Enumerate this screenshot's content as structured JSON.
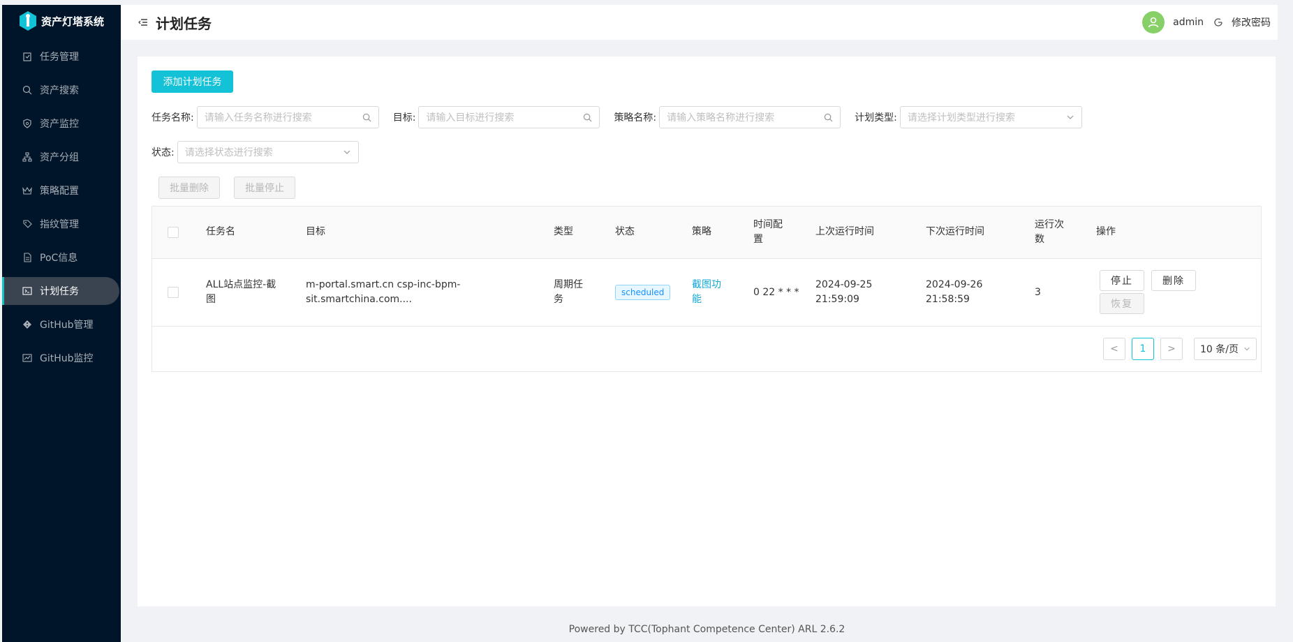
{
  "app": {
    "title": "资产灯塔系统"
  },
  "sidebar": {
    "items": [
      {
        "label": "任务管理",
        "icon": "clipboard-icon"
      },
      {
        "label": "资产搜索",
        "icon": "search-icon"
      },
      {
        "label": "资产监控",
        "icon": "monitor-icon"
      },
      {
        "label": "资产分组",
        "icon": "cluster-icon"
      },
      {
        "label": "策略配置",
        "icon": "crown-icon"
      },
      {
        "label": "指纹管理",
        "icon": "tag-icon"
      },
      {
        "label": "PoC信息",
        "icon": "file-icon"
      },
      {
        "label": "计划任务",
        "icon": "code-icon",
        "active": true
      },
      {
        "label": "GitHub管理",
        "icon": "git-icon"
      },
      {
        "label": "GitHub监控",
        "icon": "fund-icon"
      }
    ]
  },
  "header": {
    "title": "计划任务",
    "user": "admin",
    "change_password": "修改密码"
  },
  "toolbar": {
    "add_label": "添加计划任务"
  },
  "filters": {
    "task_name_label": "任务名称:",
    "task_name_placeholder": "请输入任务名称进行搜索",
    "target_label": "目标:",
    "target_placeholder": "请输入目标进行搜索",
    "policy_label": "策略名称:",
    "policy_placeholder": "请输入策略名称进行搜索",
    "plan_type_label": "计划类型:",
    "plan_type_placeholder": "请选择计划类型进行搜索",
    "status_label": "状态:",
    "status_placeholder": "请选择状态进行搜索"
  },
  "batch": {
    "delete_label": "批量删除",
    "stop_label": "批量停止"
  },
  "table": {
    "headers": {
      "name": "任务名",
      "target": "目标",
      "type": "类型",
      "status": "状态",
      "policy": "策略",
      "time_l1": "时间配",
      "time_l2": "置",
      "last_run": "上次运行时间",
      "next_run": "下次运行时间",
      "count_l1": "运行次",
      "count_l2": "数",
      "actions": "操作"
    },
    "rows": [
      {
        "name_l1": "ALL站点监控-截",
        "name_l2": "图",
        "target_l1": "m-portal.smart.cn csp-inc-bpm-",
        "target_l2": "sit.smartchina.com....",
        "type_l1": "周期任",
        "type_l2": "务",
        "status": "scheduled",
        "policy_l1": "截图功",
        "policy_l2": "能",
        "cron": "0 22 * * *",
        "last_l1": "2024-09-25",
        "last_l2": "21:59:09",
        "next_l1": "2024-09-26",
        "next_l2": "21:58:59",
        "count": "3",
        "stop_label": "停止",
        "delete_label": "删除",
        "restore_label": "恢复"
      }
    ]
  },
  "pagination": {
    "prev": "<",
    "current": "1",
    "next": ">",
    "page_size": "10 条/页"
  },
  "footer": {
    "text": "Powered by TCC(Tophant Competence Center) ARL 2.6.2"
  },
  "colors": {
    "sidebar_bg": "#001529",
    "accent": "#13c2d6",
    "avatar": "#87d068"
  }
}
